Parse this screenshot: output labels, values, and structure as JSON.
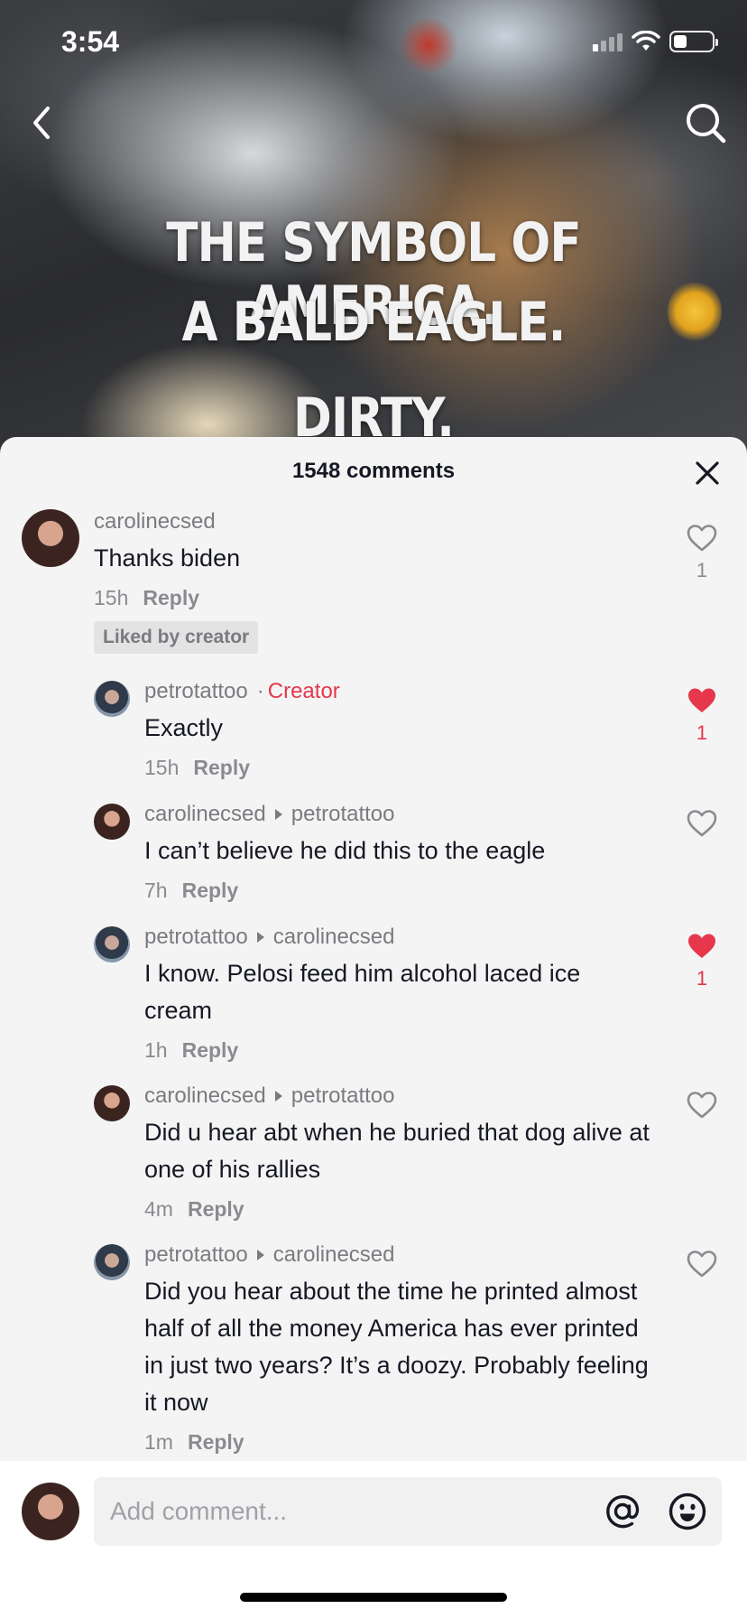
{
  "status_bar": {
    "time": "3:54"
  },
  "video": {
    "overlay_lines": [
      "THE SYMBOL OF AMERICA.",
      "A BALD EAGLE.",
      "DIRTY."
    ]
  },
  "comments_panel": {
    "title": "1548 comments",
    "comments": [
      {
        "username": "carolinecsed",
        "text": "Thanks biden",
        "time": "15h",
        "reply_label": "Reply",
        "badge": "Liked by creator",
        "likes": "1",
        "liked": false
      }
    ],
    "replies": [
      {
        "username": "petrotattoo",
        "creator_tag": "Creator",
        "separator": "·",
        "text": "Exactly",
        "time": "15h",
        "reply_label": "Reply",
        "likes": "1",
        "liked": true
      },
      {
        "username": "carolinecsed",
        "reply_to": "petrotattoo",
        "text": "I can’t believe he did this to the eagle",
        "time": "7h",
        "reply_label": "Reply",
        "likes": "",
        "liked": false
      },
      {
        "username": "petrotattoo",
        "reply_to": "carolinecsed",
        "text": "I know. Pelosi feed him alcohol laced ice cream",
        "time": "1h",
        "reply_label": "Reply",
        "likes": "1",
        "liked": true
      },
      {
        "username": "carolinecsed",
        "reply_to": "petrotattoo",
        "text": "Did u hear abt when he buried that dog alive at one of his rallies",
        "time": "4m",
        "reply_label": "Reply",
        "likes": "",
        "liked": false
      },
      {
        "username": "petrotattoo",
        "reply_to": "carolinecsed",
        "text": "Did you hear about the time he printed almost half of all the money America has ever printed in just two years? It’s a doozy. Probably feeling it now",
        "time": "1m",
        "reply_label": "Reply",
        "likes": "",
        "liked": false
      }
    ]
  },
  "input": {
    "placeholder": "Add comment..."
  },
  "colors": {
    "accent": "#e6374c",
    "sheet_bg": "#f4f4f4",
    "text": "#161823",
    "muted": "#8a8b91"
  },
  "icons": [
    "back-icon",
    "search-icon",
    "close-icon",
    "heart-icon",
    "heart-filled-icon",
    "at-icon",
    "emoji-icon"
  ]
}
